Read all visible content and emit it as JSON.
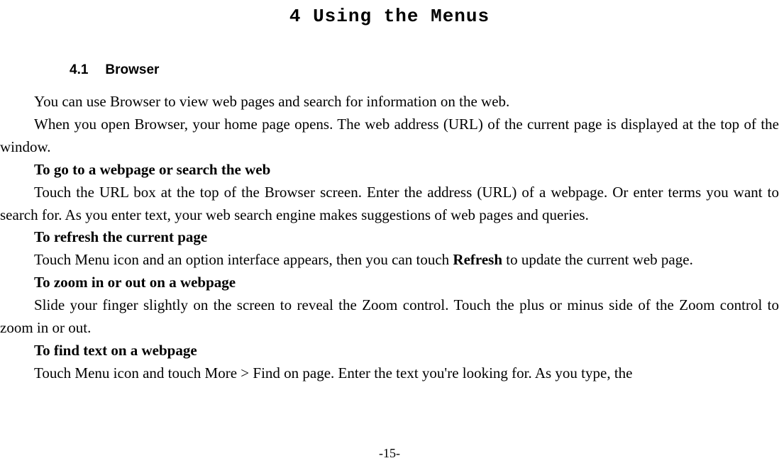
{
  "title": "4 Using the Menus",
  "section": {
    "number": "4.1",
    "name": "Browser"
  },
  "paragraphs": {
    "p1": "You can use Browser to view web pages and search for information on the web.",
    "p2": "When you open Browser, your home page opens. The web address (URL) of the current page is displayed at the top of the window.",
    "h1": "To go to a webpage or search the web",
    "p3": "Touch the URL box at the top of the Browser screen. Enter the address (URL) of a webpage. Or enter terms you want to search for. As you enter text, your web search engine makes suggestions of web pages and queries.",
    "h2": "To refresh the current page",
    "p4a": "Touch Menu icon and an option interface appears, then you can touch ",
    "p4b_bold": "Refresh",
    "p4c": " to update the current web page.",
    "h3": "To zoom in or out on a webpage",
    "p5": "Slide your finger slightly on the screen to reveal the Zoom control. Touch the plus or minus side of the Zoom control to zoom in or out.",
    "h4": "To find text on a webpage",
    "p6": "Touch Menu icon and touch More > Find on page. Enter the text you're looking for. As you type, the"
  },
  "page_number": "-15-"
}
